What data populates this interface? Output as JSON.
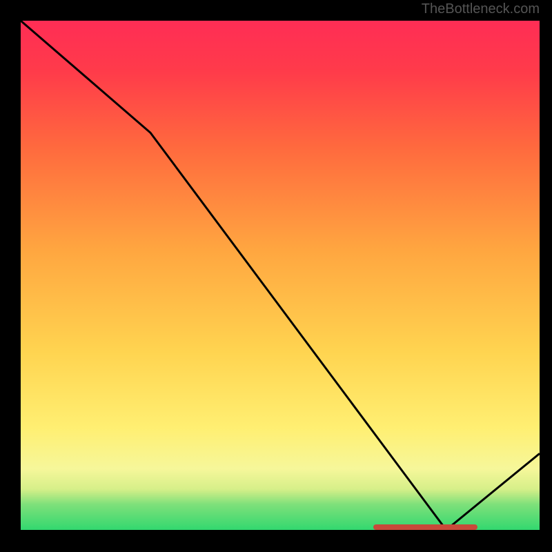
{
  "watermark": "TheBottleneck.com",
  "chart_data": {
    "type": "line",
    "title": "",
    "xlabel": "",
    "ylabel": "",
    "xlim": [
      0,
      100
    ],
    "ylim": [
      0,
      100
    ],
    "series": [
      {
        "name": "curve",
        "x": [
          0,
          25,
          82,
          100
        ],
        "values": [
          100,
          78,
          0,
          15
        ]
      }
    ],
    "marker": {
      "x_start": 68,
      "x_end": 88,
      "y": 0,
      "color": "#c84a3a"
    },
    "gradient_stops": [
      {
        "offset": 0,
        "color": "#32d86f"
      },
      {
        "offset": 5,
        "color": "#7ee07a"
      },
      {
        "offset": 8,
        "color": "#d6ef89"
      },
      {
        "offset": 12,
        "color": "#f6f79a"
      },
      {
        "offset": 20,
        "color": "#ffef72"
      },
      {
        "offset": 35,
        "color": "#ffd450"
      },
      {
        "offset": 55,
        "color": "#ffa640"
      },
      {
        "offset": 75,
        "color": "#ff6a3e"
      },
      {
        "offset": 90,
        "color": "#ff3b4a"
      },
      {
        "offset": 100,
        "color": "#ff2d55"
      }
    ]
  }
}
